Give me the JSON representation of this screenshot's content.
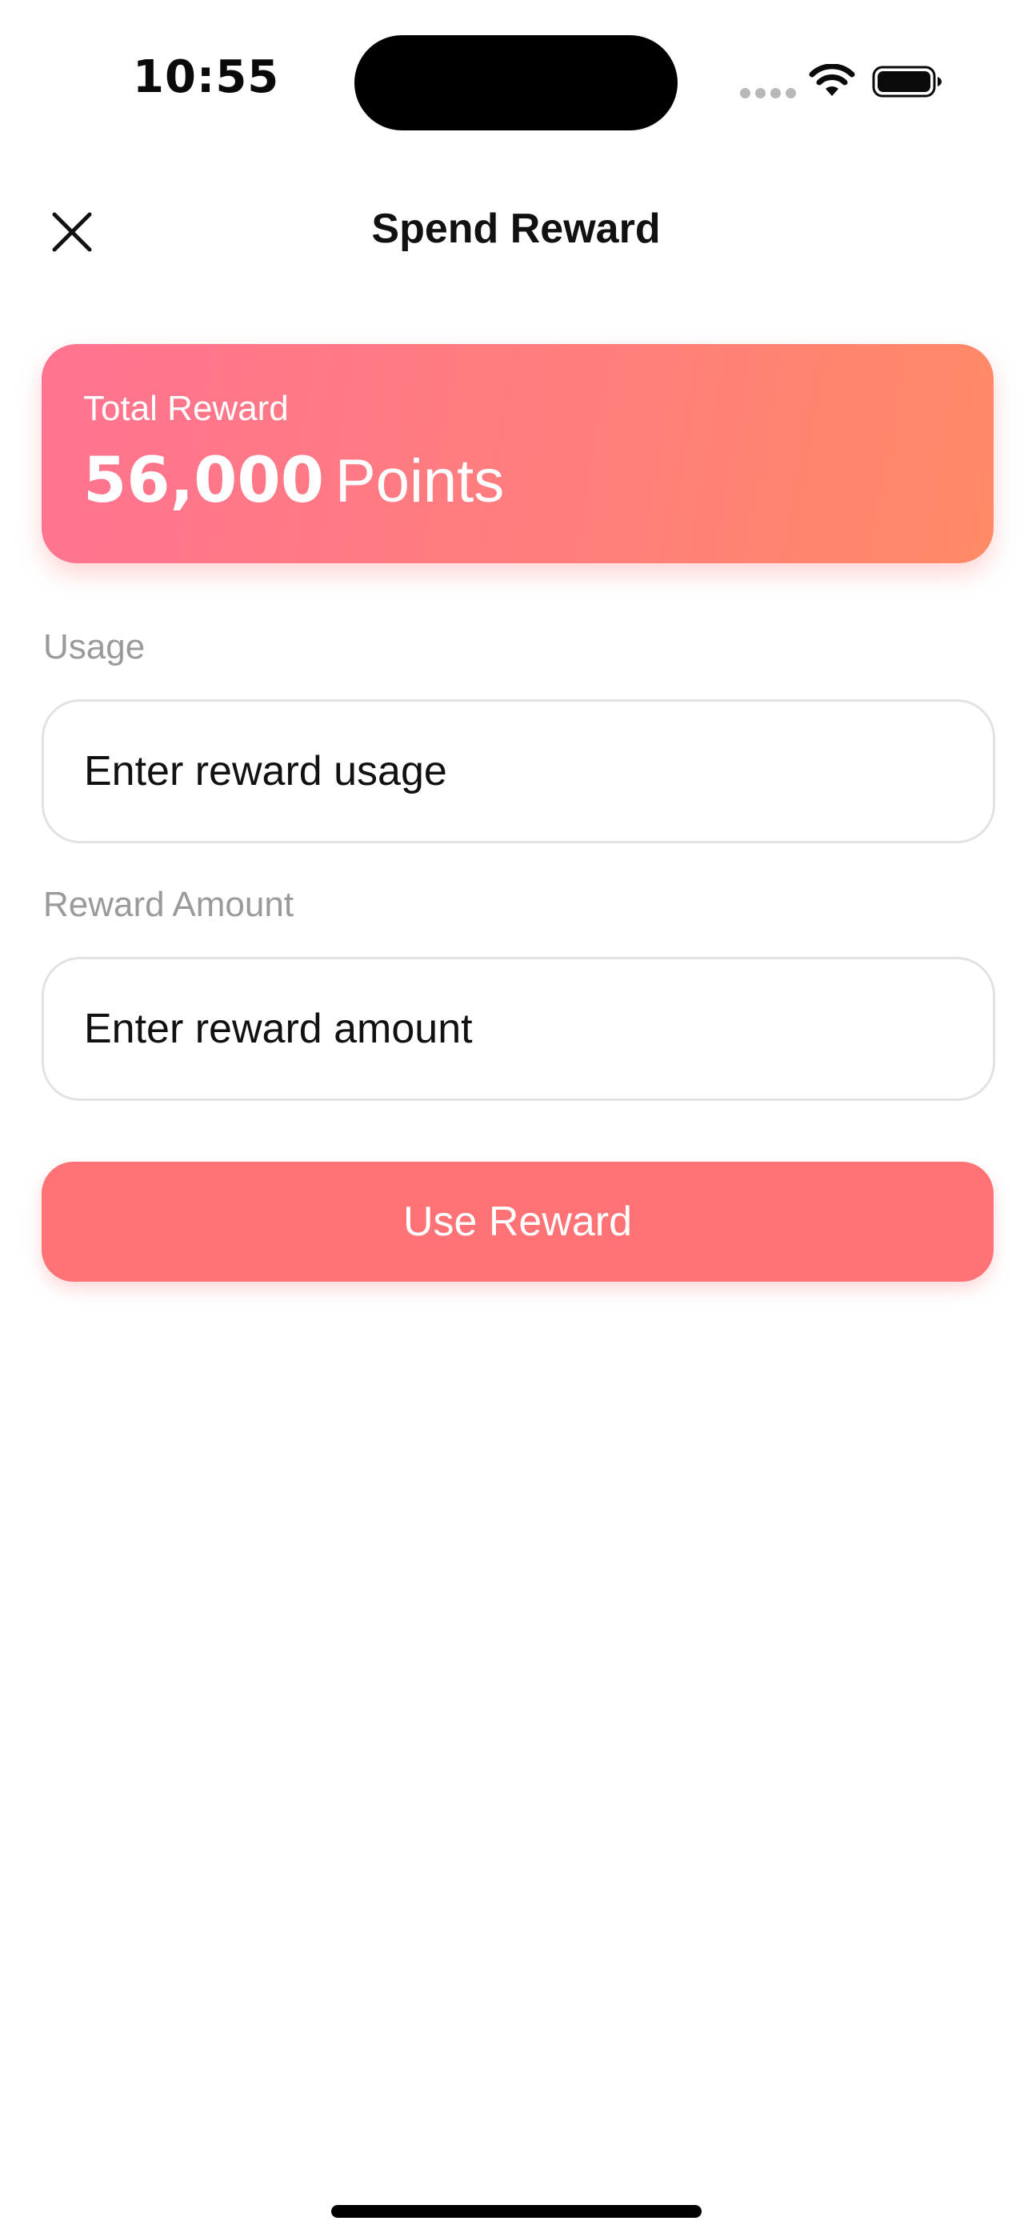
{
  "status_bar": {
    "time": "10:55",
    "icons": [
      "cellular-signal-icon",
      "wifi-icon",
      "battery-icon"
    ]
  },
  "header": {
    "close_icon": "close-icon",
    "title": "Spend Reward"
  },
  "reward_card": {
    "label": "Total Reward",
    "points": "56,000",
    "unit": "Points",
    "gradient_start": "#ff7390",
    "gradient_end": "#ff8a66"
  },
  "form": {
    "usage": {
      "label": "Usage",
      "value": "",
      "placeholder": "Enter reward usage"
    },
    "amount": {
      "label": "Reward Amount",
      "value": "",
      "placeholder": "Enter reward amount"
    }
  },
  "actions": {
    "submit_label": "Use Reward",
    "submit_color": "#ff7276"
  }
}
